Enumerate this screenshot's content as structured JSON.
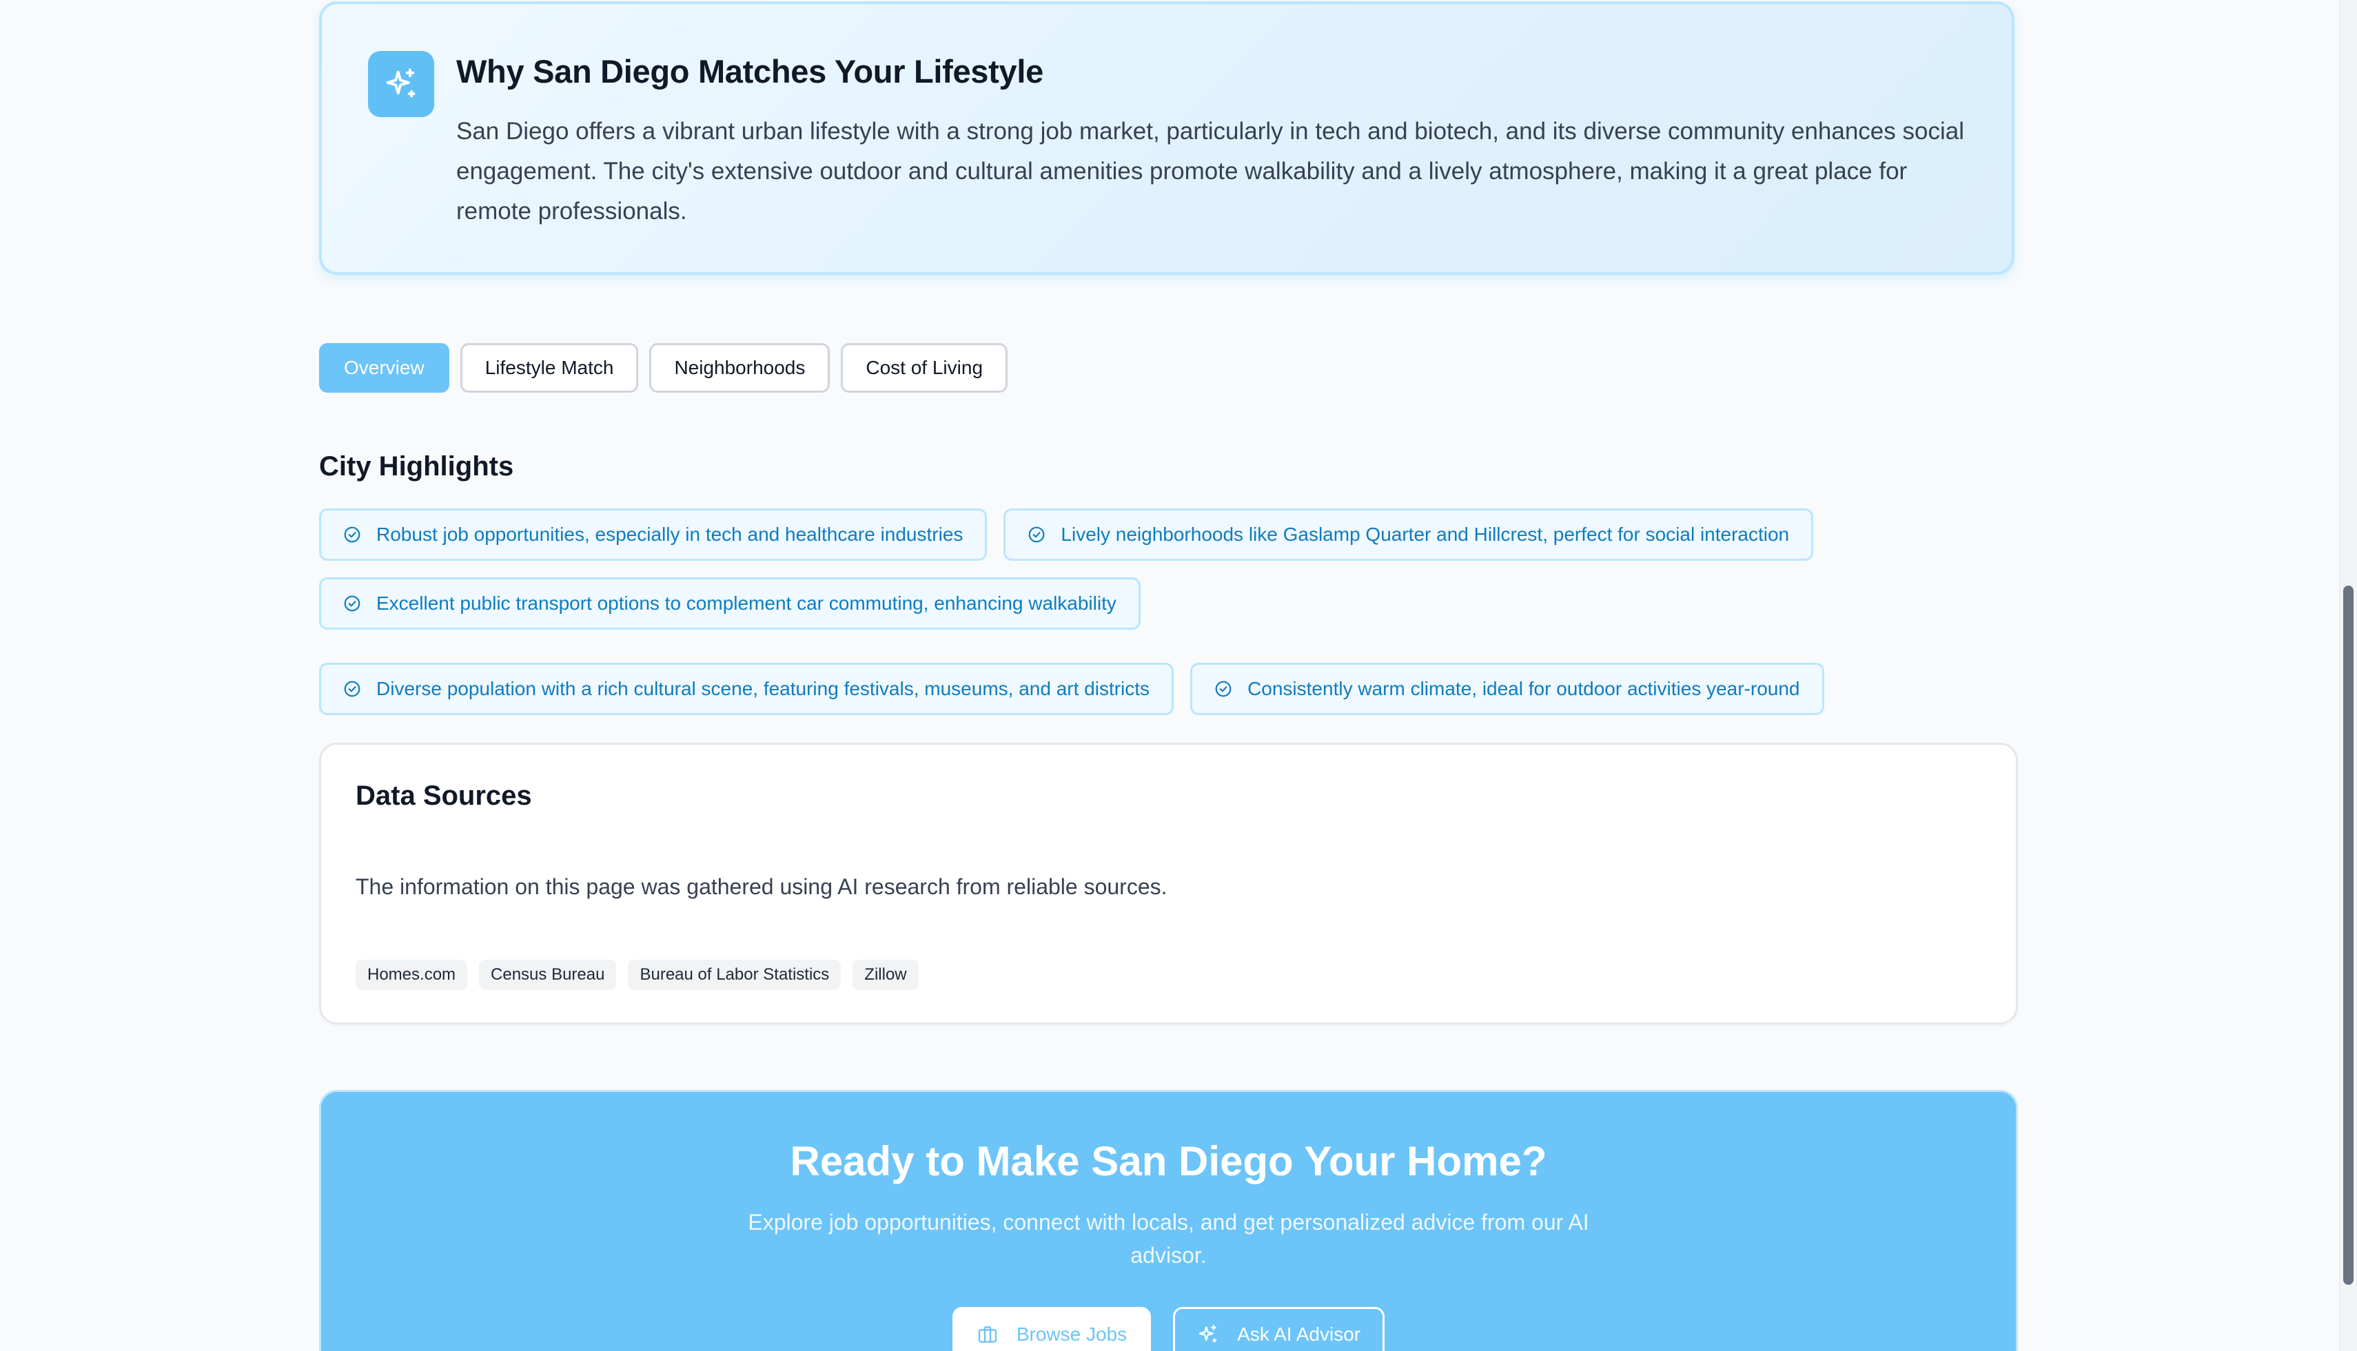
{
  "match": {
    "icon": "sparkles-icon",
    "title": "Why San Diego Matches Your Lifestyle",
    "text": "San Diego offers a vibrant urban lifestyle with a strong job market, particularly in tech and biotech, and its diverse community enhances social engagement. The city's extensive outdoor and cultural amenities promote walkability and a lively atmosphere, making it a great place for remote professionals."
  },
  "tabs": [
    {
      "label": "Overview",
      "active": true
    },
    {
      "label": "Lifestyle Match",
      "active": false
    },
    {
      "label": "Neighborhoods",
      "active": false
    },
    {
      "label": "Cost of Living",
      "active": false
    }
  ],
  "highlights": {
    "title": "City Highlights",
    "icon": "check-circle-icon",
    "items": [
      "Robust job opportunities, especially in tech and healthcare industries",
      "Lively neighborhoods like Gaslamp Quarter and Hillcrest, perfect for social interaction",
      "Excellent public transport options to complement car commuting, enhancing walkability",
      "Diverse population with a rich cultural scene, featuring festivals, museums, and art districts",
      "Consistently warm climate, ideal for outdoor activities year-round"
    ]
  },
  "sources": {
    "title": "Data Sources",
    "text": "The information on this page was gathered using AI research from reliable sources.",
    "tags": [
      "Homes.com",
      "Census Bureau",
      "Bureau of Labor Statistics",
      "Zillow"
    ]
  },
  "cta": {
    "title": "Ready to Make San Diego Your Home?",
    "text": "Explore job opportunities, connect with locals, and get personalized advice from our AI advisor.",
    "primary_label": "Browse Jobs",
    "primary_icon": "briefcase-icon",
    "secondary_label": "Ask AI Advisor",
    "secondary_icon": "sparkles-icon"
  },
  "colors": {
    "accent": "#6cc4f8",
    "chip_text": "#0e7cc0",
    "chip_border": "#bae6fd"
  }
}
